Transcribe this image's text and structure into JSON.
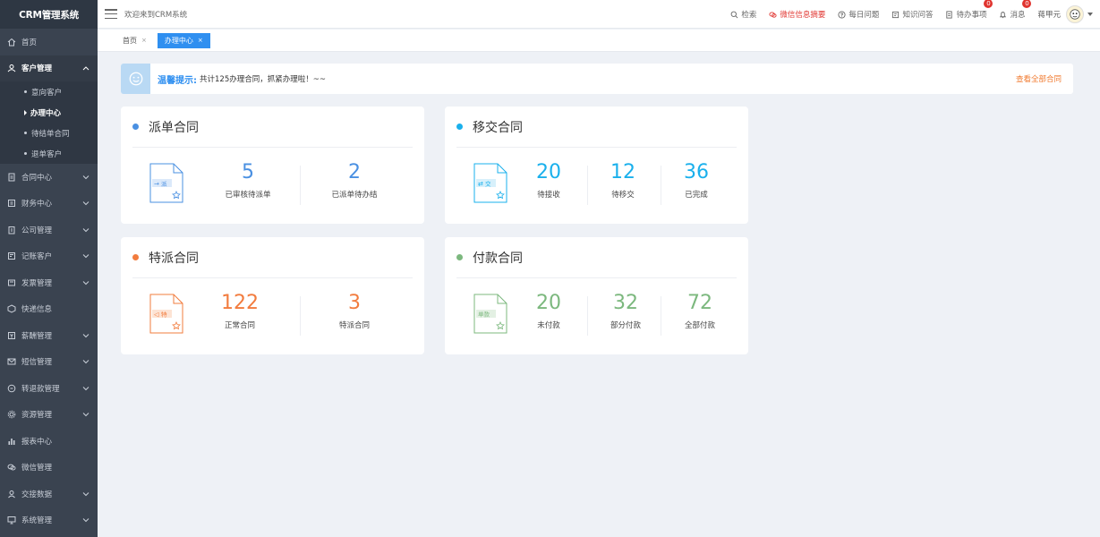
{
  "app": {
    "logo": "CRM管理系统"
  },
  "header": {
    "welcome": "欢迎来到CRM系统",
    "links": {
      "search": "检索",
      "wechat_summary": "微信信息摘要",
      "daily_question": "每日问题",
      "knowledge_qa": "知识问答",
      "todo": "待办事项",
      "messages": "消息"
    },
    "todo_badge": "0",
    "messages_badge": "0",
    "user_name": "蒋甲元"
  },
  "sidebar": {
    "items": [
      {
        "label": "首页"
      },
      {
        "label": "客户管理"
      },
      {
        "label": "合同中心"
      },
      {
        "label": "财务中心"
      },
      {
        "label": "公司管理"
      },
      {
        "label": "记账客户"
      },
      {
        "label": "发票管理"
      },
      {
        "label": "快递信息"
      },
      {
        "label": "薪酬管理"
      },
      {
        "label": "短信管理"
      },
      {
        "label": "转退款管理"
      },
      {
        "label": "资源管理"
      },
      {
        "label": "报表中心"
      },
      {
        "label": "微信管理"
      },
      {
        "label": "交接数据"
      },
      {
        "label": "系统管理"
      }
    ],
    "customer_sub": [
      {
        "label": "意向客户"
      },
      {
        "label": "办理中心"
      },
      {
        "label": "待结单合同"
      },
      {
        "label": "退单客户"
      }
    ]
  },
  "tabs": [
    {
      "label": "首页"
    },
    {
      "label": "办理中心"
    }
  ],
  "notice": {
    "title": "温馨提示:",
    "text": "共计125办理合同，抓紧办理啦！~~",
    "link": "查看全部合同"
  },
  "cards": {
    "dispatch": {
      "title": "派单合同",
      "icon_tag": "派",
      "stats": [
        {
          "value": "5",
          "label": "已审核待派单"
        },
        {
          "value": "2",
          "label": "已派单待办结"
        }
      ]
    },
    "transfer": {
      "title": "移交合同",
      "icon_tag": "交",
      "stats": [
        {
          "value": "20",
          "label": "待接收"
        },
        {
          "value": "12",
          "label": "待移交"
        },
        {
          "value": "36",
          "label": "已完成"
        }
      ]
    },
    "special": {
      "title": "特派合同",
      "icon_tag": "特",
      "stats": [
        {
          "value": "122",
          "label": "正常合同"
        },
        {
          "value": "3",
          "label": "特派合同"
        }
      ]
    },
    "payment": {
      "title": "付款合同",
      "icon_tag": "单款",
      "stats": [
        {
          "value": "20",
          "label": "未付款"
        },
        {
          "value": "32",
          "label": "部分付款"
        },
        {
          "value": "72",
          "label": "全部付款"
        }
      ]
    }
  },
  "colors": {
    "blue": "#4a90e2",
    "cyan": "#1ab0ec",
    "orange": "#f27c3e",
    "green": "#7cb87e"
  }
}
